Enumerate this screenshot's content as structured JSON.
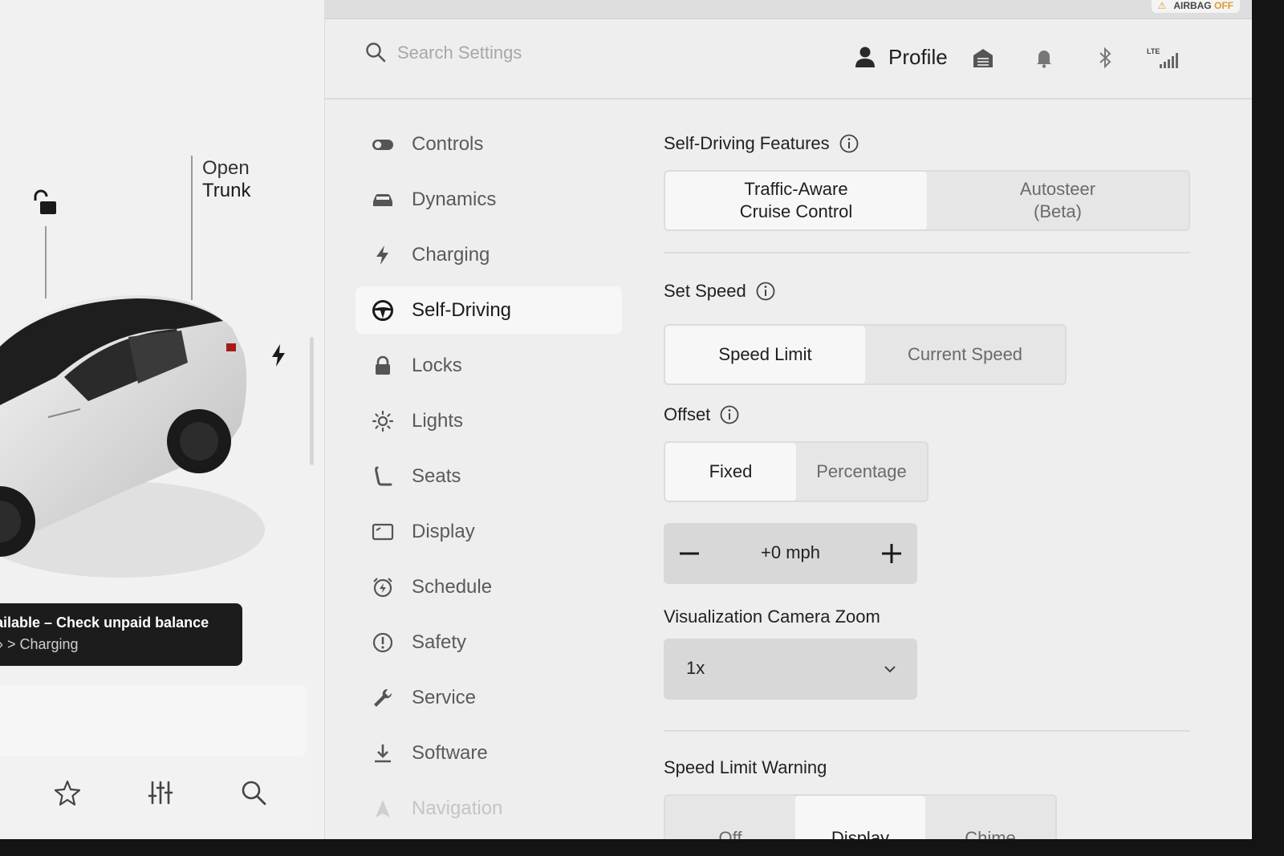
{
  "car_panel": {
    "trunk_line1": "Open",
    "trunk_line2": "Trunk",
    "toast_line1": "ailable – Check unpaid balance",
    "toast_line2": "› > Charging"
  },
  "header": {
    "airbag_label": "AIRBAG",
    "airbag_state": "OFF",
    "search_placeholder": "Search Settings",
    "profile_label": "Profile"
  },
  "nav": {
    "items": [
      {
        "label": "Controls",
        "icon": "toggle-icon"
      },
      {
        "label": "Dynamics",
        "icon": "car-icon"
      },
      {
        "label": "Charging",
        "icon": "bolt-icon"
      },
      {
        "label": "Self-Driving",
        "icon": "steering-wheel-icon",
        "active": true
      },
      {
        "label": "Locks",
        "icon": "lock-icon"
      },
      {
        "label": "Lights",
        "icon": "sun-icon"
      },
      {
        "label": "Seats",
        "icon": "seat-icon"
      },
      {
        "label": "Display",
        "icon": "display-icon"
      },
      {
        "label": "Schedule",
        "icon": "alarm-clock-icon"
      },
      {
        "label": "Safety",
        "icon": "alert-circle-icon"
      },
      {
        "label": "Service",
        "icon": "wrench-icon"
      },
      {
        "label": "Software",
        "icon": "download-icon"
      },
      {
        "label": "Navigation",
        "icon": "navigation-arrow-icon"
      }
    ]
  },
  "self_driving": {
    "features_title": "Self-Driving Features",
    "features_options": [
      "Traffic-Aware\nCruise Control",
      "Autosteer\n(Beta)"
    ],
    "features_selected": 0,
    "set_speed_title": "Set Speed",
    "set_speed_options": [
      "Speed Limit",
      "Current Speed"
    ],
    "set_speed_selected": 0,
    "offset_title": "Offset",
    "offset_options": [
      "Fixed",
      "Percentage"
    ],
    "offset_selected": 0,
    "offset_value": "+0 mph",
    "camera_zoom_title": "Visualization Camera Zoom",
    "camera_zoom_value": "1x",
    "speed_limit_warning_title": "Speed Limit Warning",
    "speed_limit_warning_options": [
      "Off",
      "Display",
      "Chime"
    ],
    "speed_limit_warning_selected": 1
  }
}
